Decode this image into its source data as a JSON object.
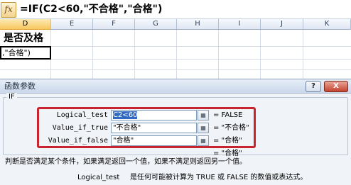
{
  "formula_bar": {
    "fx_label": "fx",
    "formula": "=IF(C2<60,\"不合格\",\"合格\")"
  },
  "sheet": {
    "columns": [
      "D",
      "E",
      "F",
      "G",
      "H",
      "I",
      "J",
      "K"
    ],
    "active_column": "D",
    "cell_d1": "是否及格",
    "cell_d2": ",\"合格\")"
  },
  "dialog": {
    "title": "函数参数",
    "help_label": "?",
    "close_label": "X",
    "function_name": "IF",
    "arguments": [
      {
        "label": "Logical_test",
        "value": "C2<60",
        "result": "= FALSE"
      },
      {
        "label": "Value_if_true",
        "value": "\"不合格\"",
        "result": "= \"不合格\""
      },
      {
        "label": "Value_if_false",
        "value": "\"合格\"",
        "result": "= \"合格\""
      }
    ],
    "collapse_icon_label": "▦",
    "formula_result": "= \"合格\"",
    "description": "判断是否满足某个条件，如果满足返回一个值，如果不满足则返回另一个值。",
    "param_name": "Logical_test",
    "param_description": "是任何可能被计算为 TRUE 或 FALSE 的数值或表达式。"
  },
  "colors": {
    "highlight_frame": "#c8242d",
    "active_column_header": "#f7c85f",
    "selection": "#316ac5"
  }
}
